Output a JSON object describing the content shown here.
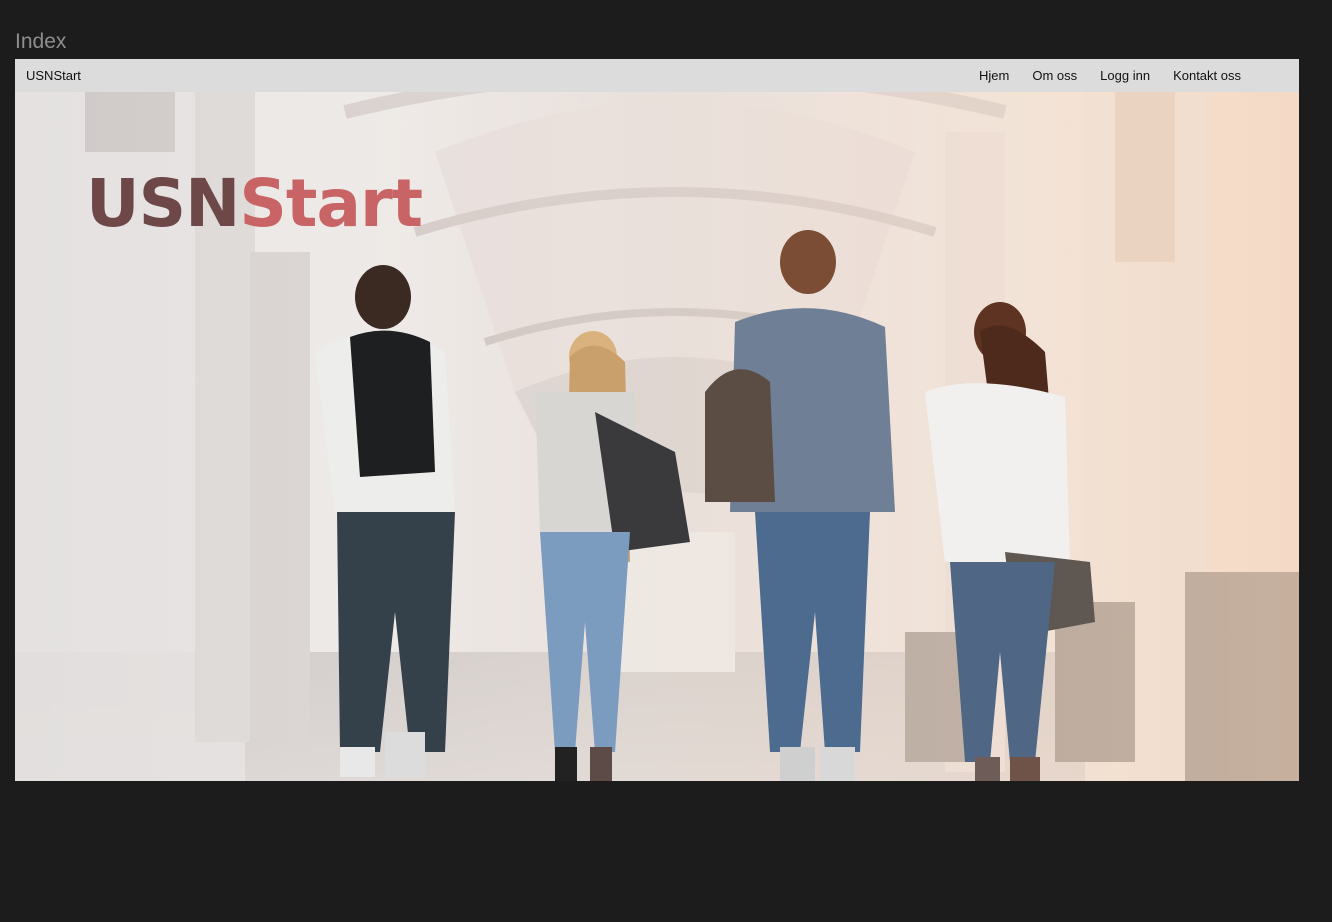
{
  "frame": {
    "label": "Index"
  },
  "navbar": {
    "brand": "USNStart",
    "links": [
      "Hjem",
      "Om oss",
      "Logg inn",
      "Kontakt oss"
    ]
  },
  "hero": {
    "title_part1": "USN",
    "title_part2": "Start",
    "image": "students-walking-in-arched-corridor"
  },
  "colors": {
    "background": "#1c1c1c",
    "navbar": "#dcdcdc",
    "title_dark": "#6e4748",
    "title_accent": "#c86466"
  }
}
